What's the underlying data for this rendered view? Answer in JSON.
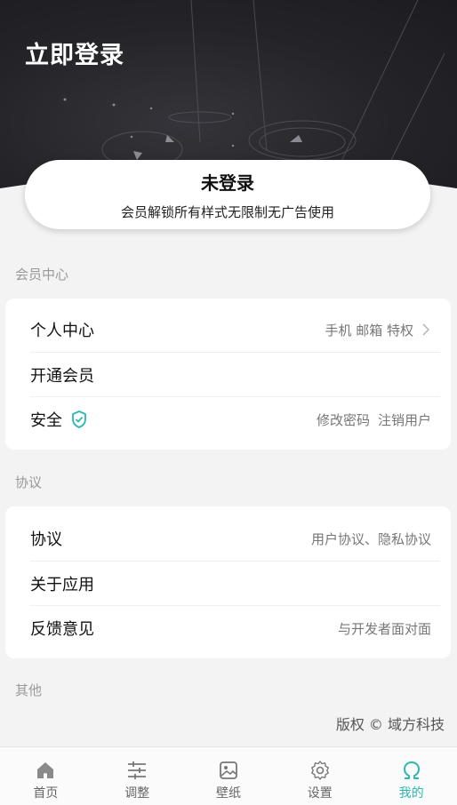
{
  "header": {
    "title": "立即登录"
  },
  "login_card": {
    "status": "未登录",
    "description": "会员解锁所有样式无限制无广告使用"
  },
  "sections": {
    "member": {
      "title": "会员中心",
      "rows": {
        "personal": {
          "label": "个人中心",
          "right": "手机 邮箱 特权"
        },
        "vip": {
          "label": "开通会员"
        },
        "security": {
          "label": "安全",
          "right1": "修改密码",
          "right2": "注销用户"
        }
      }
    },
    "agreement": {
      "title": "协议",
      "rows": {
        "agreement": {
          "label": "协议",
          "right": "用户协议、隐私协议"
        },
        "about": {
          "label": "关于应用"
        },
        "feedback": {
          "label": "反馈意见",
          "right": "与开发者面对面"
        }
      }
    },
    "other": {
      "title": "其他"
    }
  },
  "copyright": "版权 © 域方科技",
  "tabbar": {
    "home": {
      "label": "首页",
      "icon": "home-icon"
    },
    "adjust": {
      "label": "调整",
      "icon": "sliders-icon"
    },
    "wallpaper": {
      "label": "壁纸",
      "icon": "image-icon"
    },
    "settings": {
      "label": "设置",
      "icon": "gear-icon"
    },
    "mine": {
      "label": "我的",
      "icon": "omega-icon"
    }
  },
  "colors": {
    "accent": "#2ab8b0",
    "header_bg": "#242428",
    "page_bg": "#f3f3f3"
  }
}
